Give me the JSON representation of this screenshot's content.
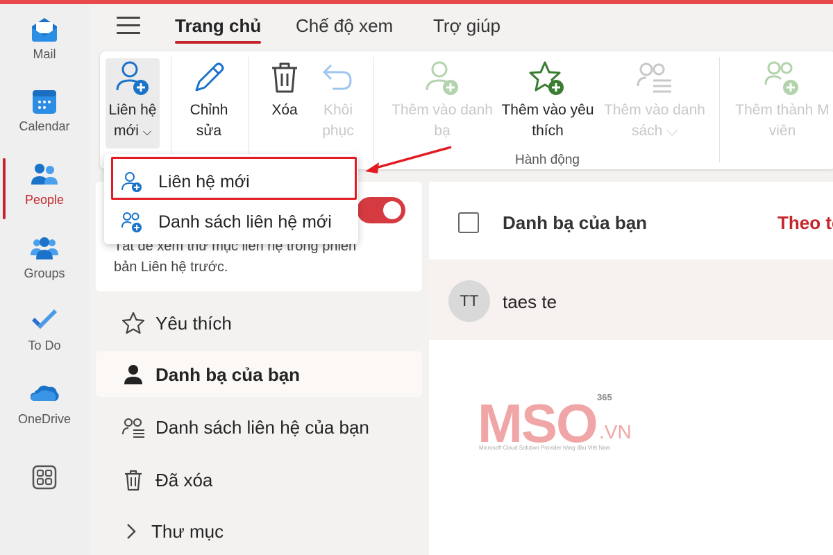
{
  "colors": {
    "accent": "#c4262e",
    "annotation": "#e21b22",
    "top_strip": "#e8494b"
  },
  "rail": {
    "items": [
      {
        "label": "Mail",
        "icon": "mail-icon"
      },
      {
        "label": "Calendar",
        "icon": "calendar-icon"
      },
      {
        "label": "People",
        "icon": "people-icon",
        "active": true
      },
      {
        "label": "Groups",
        "icon": "groups-icon"
      },
      {
        "label": "To Do",
        "icon": "todo-icon"
      },
      {
        "label": "OneDrive",
        "icon": "onedrive-icon"
      },
      {
        "label": "",
        "icon": "apps-icon"
      }
    ]
  },
  "menu": {
    "tabs": [
      "Trang chủ",
      "Chế độ xem",
      "Trợ giúp"
    ],
    "active_tab": "Trang chủ"
  },
  "ribbon": {
    "new_contact": "Liên hệ",
    "new_contact_2": "mới",
    "new_contact_chevron": "⌵",
    "edit": "Chỉnh",
    "edit_2": "sửa",
    "delete": "Xóa",
    "restore": "Khôi",
    "restore_2": "phục",
    "add_contacts": "Thêm vào danh",
    "add_contacts_2": "bạ",
    "add_favorites": "Thêm vào yêu",
    "add_favorites_2": "thích",
    "add_list": "Thêm vào danh",
    "add_list_2": "sách ⌵",
    "add_member": "Thêm thành M",
    "add_member_2": "viên",
    "group_label": "Hành động"
  },
  "dropdown": {
    "items": [
      "Liên hệ mới",
      "Danh sách liên hệ mới"
    ]
  },
  "panel": {
    "notice_line1": "Tắt để xem thư mục liên hệ trong phiên",
    "notice_line2": "bản Liên hệ trước.",
    "toggle_on": true,
    "nav": [
      "Yêu thích",
      "Danh bạ của bạn",
      "Danh sách liên hệ của bạn",
      "Đã xóa",
      "Thư mục"
    ],
    "selected": "Danh bạ của bạn"
  },
  "main": {
    "title": "Danh bạ của bạn",
    "sort_label": "Theo tê",
    "contacts": [
      {
        "initials": "TT",
        "name": "taes te"
      }
    ]
  },
  "watermark": {
    "brand": "MSO",
    "sup": "365",
    "domain": ".VN",
    "tagline": "Microsoft Cloud Solution Provider hàng đầu Việt Nam"
  }
}
